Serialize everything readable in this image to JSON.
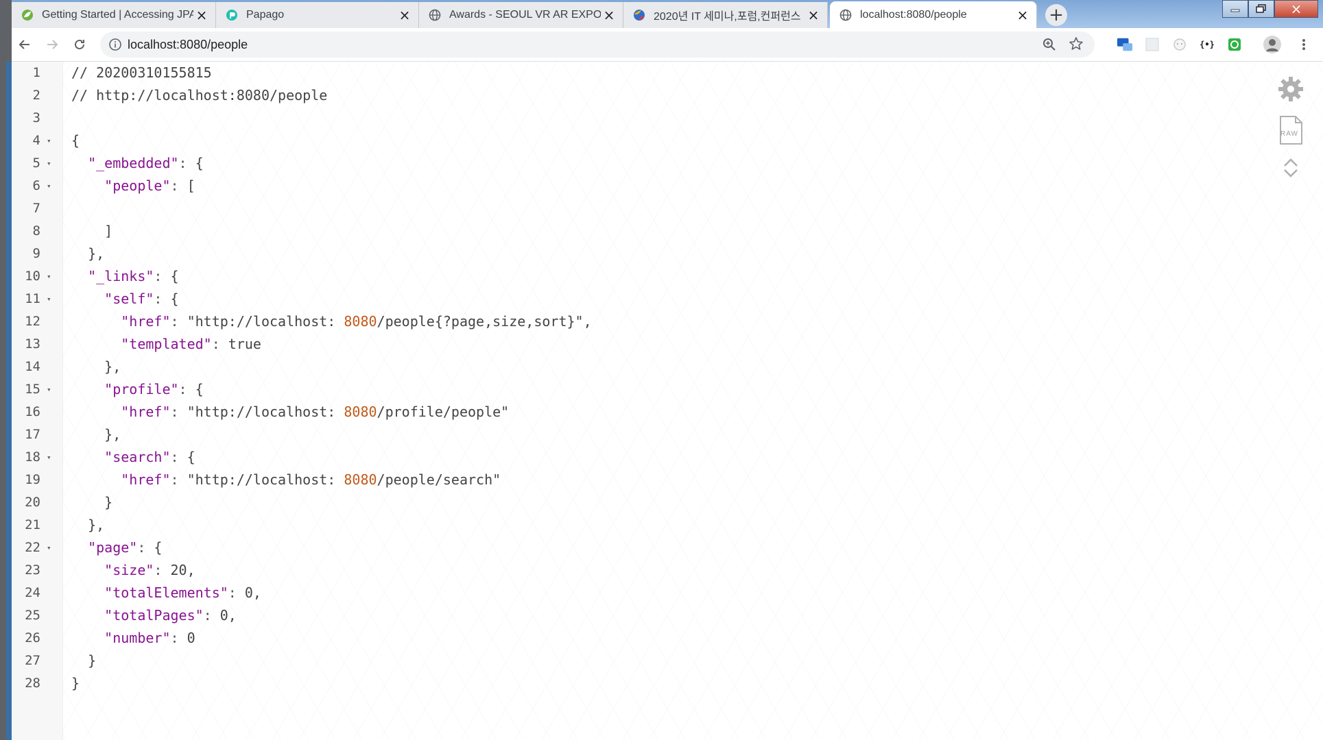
{
  "tabs": [
    {
      "title": "Getting Started | Accessing JPA",
      "icon": "spring-leaf-icon",
      "active": false
    },
    {
      "title": "Papago",
      "icon": "papago-icon",
      "active": false
    },
    {
      "title": "Awards - SEOUL VR AR EXPO %",
      "icon": "globe-icon",
      "active": false
    },
    {
      "title": "2020년 IT 세미나,포럼,컨퍼런스",
      "icon": "colorful-globe-icon",
      "active": false
    },
    {
      "title": "localhost:8080/people",
      "icon": "globe-icon",
      "active": true
    }
  ],
  "toolbar": {
    "url": "localhost:8080/people"
  },
  "colors": {
    "key": "#881391",
    "link": "#1a5fa8",
    "number": "#c05a1a",
    "boolean": "#e08a00",
    "gutter": "#f7f7f7"
  },
  "lines": [
    {
      "n": "1",
      "fold": false,
      "text": "// 20200310155815"
    },
    {
      "n": "2",
      "fold": false,
      "text": "// http://localhost:8080/people"
    },
    {
      "n": "3",
      "fold": false,
      "text": ""
    },
    {
      "n": "4",
      "fold": true,
      "text": "{"
    },
    {
      "n": "5",
      "fold": true,
      "text": "  \"_embedded\": {"
    },
    {
      "n": "6",
      "fold": true,
      "text": "    \"people\": ["
    },
    {
      "n": "7",
      "fold": false,
      "text": ""
    },
    {
      "n": "8",
      "fold": false,
      "text": "    ]"
    },
    {
      "n": "9",
      "fold": false,
      "text": "  },"
    },
    {
      "n": "10",
      "fold": true,
      "text": "  \"_links\": {"
    },
    {
      "n": "11",
      "fold": true,
      "text": "    \"self\": {"
    },
    {
      "n": "12",
      "fold": false,
      "text": "      \"href\": \"http://localhost:8080/people{?page,size,sort}\","
    },
    {
      "n": "13",
      "fold": false,
      "text": "      \"templated\": true"
    },
    {
      "n": "14",
      "fold": false,
      "text": "    },"
    },
    {
      "n": "15",
      "fold": true,
      "text": "    \"profile\": {"
    },
    {
      "n": "16",
      "fold": false,
      "text": "      \"href\": \"http://localhost:8080/profile/people\""
    },
    {
      "n": "17",
      "fold": false,
      "text": "    },"
    },
    {
      "n": "18",
      "fold": true,
      "text": "    \"search\": {"
    },
    {
      "n": "19",
      "fold": false,
      "text": "      \"href\": \"http://localhost:8080/people/search\""
    },
    {
      "n": "20",
      "fold": false,
      "text": "    }"
    },
    {
      "n": "21",
      "fold": false,
      "text": "  },"
    },
    {
      "n": "22",
      "fold": true,
      "text": "  \"page\": {"
    },
    {
      "n": "23",
      "fold": false,
      "text": "    \"size\": 20,"
    },
    {
      "n": "24",
      "fold": false,
      "text": "    \"totalElements\": 0,"
    },
    {
      "n": "25",
      "fold": false,
      "text": "    \"totalPages\": 0,"
    },
    {
      "n": "26",
      "fold": false,
      "text": "    \"number\": 0"
    },
    {
      "n": "27",
      "fold": false,
      "text": "  }"
    },
    {
      "n": "28",
      "fold": false,
      "text": "}"
    }
  ],
  "side_buttons": {
    "settings_icon": "gear-icon",
    "raw_label": "RAW",
    "up_icon": "chevron-up-icon",
    "down_icon": "chevron-down-icon"
  }
}
